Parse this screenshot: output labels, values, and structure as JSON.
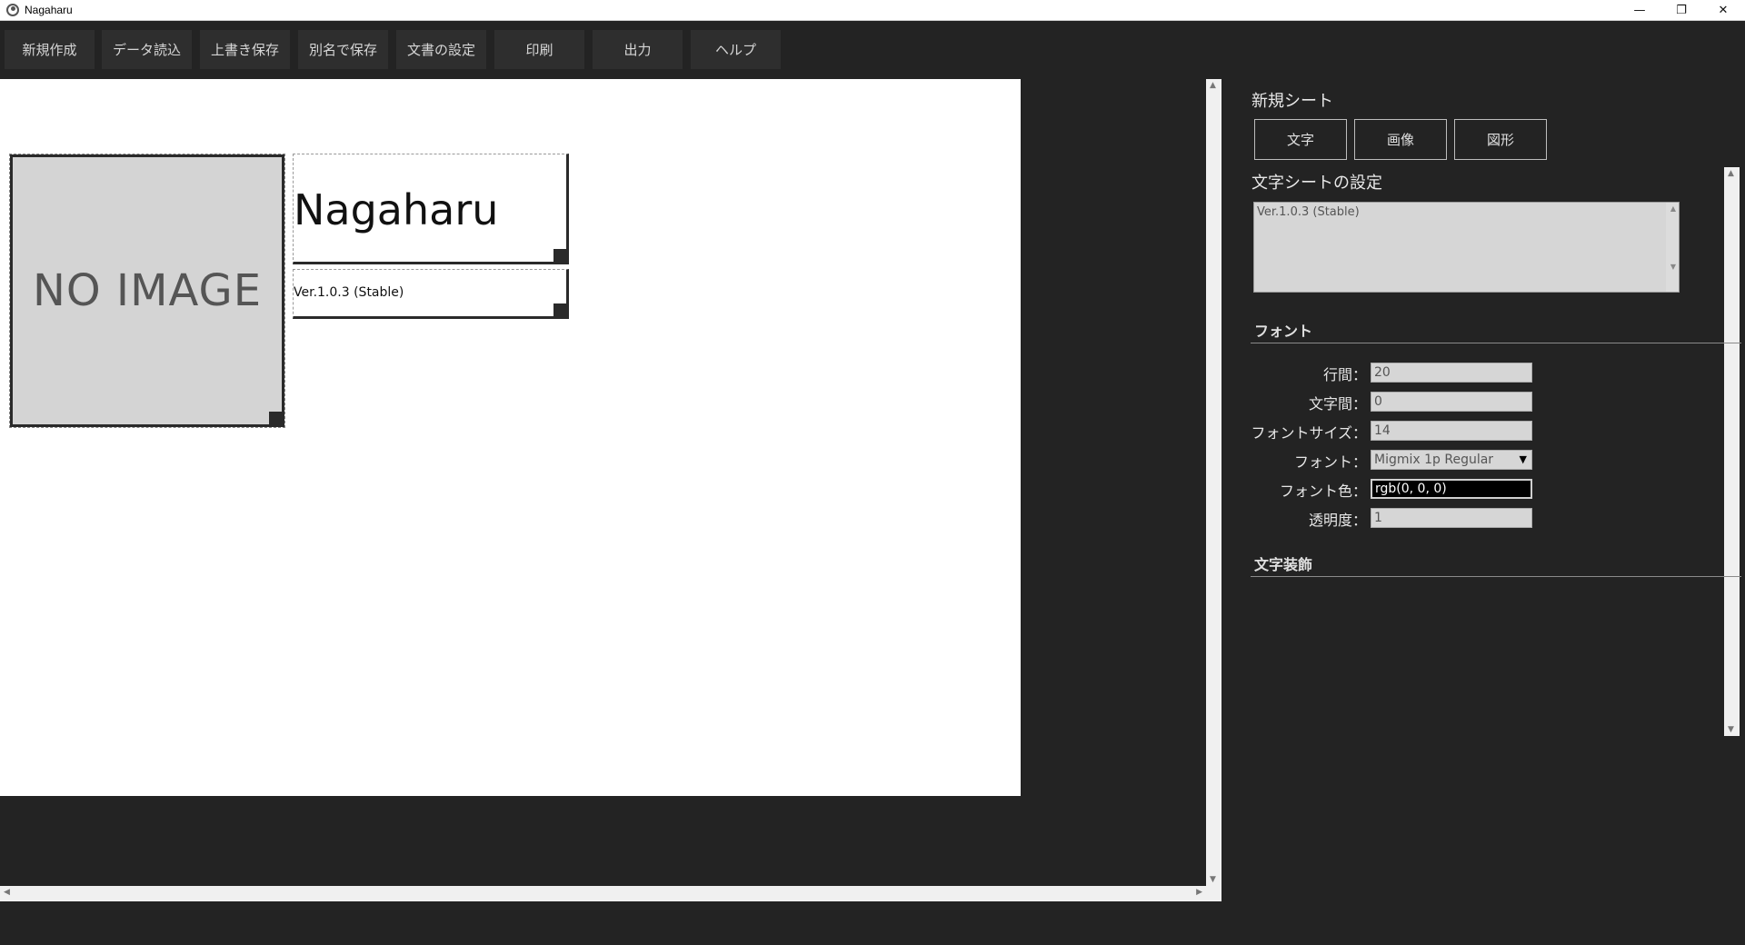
{
  "window": {
    "title": "Nagaharu",
    "minimize": "—",
    "maximize": "❐",
    "close": "✕"
  },
  "toolbar": {
    "items": [
      {
        "label": "新規作成"
      },
      {
        "label": "データ読込"
      },
      {
        "label": "上書き保存"
      },
      {
        "label": "別名で保存"
      },
      {
        "label": "文書の設定"
      },
      {
        "label": "印刷"
      },
      {
        "label": "出力"
      },
      {
        "label": "ヘルプ"
      }
    ]
  },
  "canvas": {
    "image_placeholder": "NO IMAGE",
    "text_sheet_1": "Nagaharu",
    "text_sheet_2": "Ver.1.0.3 (Stable)"
  },
  "panel": {
    "new_sheet_title": "新規シート",
    "new_buttons": [
      {
        "label": "文字"
      },
      {
        "label": "画像"
      },
      {
        "label": "図形"
      }
    ],
    "text_settings_title": "文字シートの設定",
    "text_value": "Ver.1.0.3 (Stable)",
    "font_group_title": "フォント",
    "fields": {
      "line_spacing": {
        "label": "行間：",
        "value": "20"
      },
      "letter_spacing": {
        "label": "文字間：",
        "value": "0"
      },
      "font_size": {
        "label": "フォントサイズ：",
        "value": "14"
      },
      "font": {
        "label": "フォント：",
        "value": "Migmix 1p Regular"
      },
      "font_color": {
        "label": "フォント色：",
        "value": "rgb(0, 0, 0)"
      },
      "opacity": {
        "label": "透明度：",
        "value": "1"
      }
    },
    "decoration_group_title": "文字装飾"
  },
  "colors": {
    "background": "#232323",
    "page": "#ffffff",
    "input": "#d6d6d6"
  }
}
